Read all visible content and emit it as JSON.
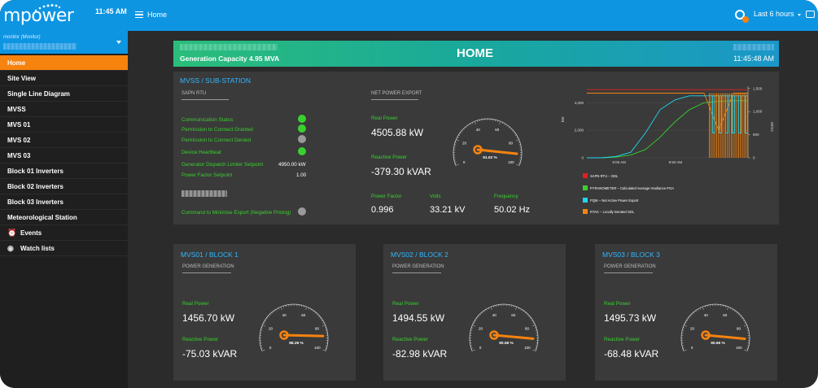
{
  "sidebar": {
    "logo_text": "mpower",
    "clock": "11:45 AM",
    "user": "monitor (Monitor)",
    "items": [
      {
        "label": "Home"
      },
      {
        "label": "Site View"
      },
      {
        "label": "Single Line Diagram"
      },
      {
        "label": "MVSS"
      },
      {
        "label": "MVS 01"
      },
      {
        "label": "MVS 02"
      },
      {
        "label": "MVS 03"
      },
      {
        "label": "Block 01 Inverters"
      },
      {
        "label": "Block 02 Inverters"
      },
      {
        "label": "Block 03 Inverters"
      },
      {
        "label": "Meteorological Station"
      },
      {
        "label": "Events",
        "icon": "alarm-clock-icon"
      },
      {
        "label": "Watch lists",
        "icon": "eye-icon"
      }
    ]
  },
  "topbar": {
    "title": "Home",
    "time_range": "Last 6 hours"
  },
  "banner": {
    "capacity": "Generation Capacity 4.95 MVA",
    "title": "HOME",
    "time": "11:45:48 AM"
  },
  "mvss": {
    "title": "MVSS / SUB-STATION",
    "rtu_label": "SAPN RTU",
    "export_label": "NET POWER EXPORT",
    "status": [
      {
        "label": "Communication Status",
        "state": "green"
      },
      {
        "label": "Permission to Connect Granted",
        "state": "green"
      },
      {
        "label": "Permission to Connect Denied",
        "state": "grey"
      },
      {
        "label": "Device Heartbeat",
        "state": "green"
      }
    ],
    "setpoint_label": "Generator Dispatch Limiter Setpoint",
    "setpoint_value": "4950.00 kW",
    "pf_setpoint_label": "Power Factor Setpoint",
    "pf_setpoint_value": "1.00",
    "command_label": "Command to Minimise Export (Negative Pricing)",
    "command_state": "grey",
    "real_power_label": "Real Power",
    "real_power": "4505.88 kW",
    "reactive_label": "Reactive Power",
    "reactive": "-379.30 kVAR",
    "pf_label": "Power Factor",
    "pf": "0.996",
    "volts_label": "Volts",
    "volts": "33.21 kV",
    "freq_label": "Frequency",
    "freq": "50.02 Hz",
    "gauge_value": 91.02,
    "gauge_text": "91.02 %"
  },
  "colors": {
    "accent": "#f7830f",
    "primary": "#0d95e2",
    "green": "#39d02f",
    "title": "#30b7ff"
  },
  "chart_data": {
    "type": "line",
    "x_ticks": [
      "9:05 AM",
      "9:50 AM"
    ],
    "y_left_ticks": [
      "0",
      "2,000",
      "4,000"
    ],
    "y_left_label": "kW",
    "y_right_ticks": [
      "0",
      "500",
      "1,000",
      "1,500"
    ],
    "y_right_label": "W/m2",
    "series": [
      {
        "name": "SAPN RTU – GDL",
        "color": "#e02020",
        "values": [
          4950,
          4950,
          4950,
          4950,
          4950,
          4950,
          4950,
          4950,
          4950,
          4950,
          4950,
          4950
        ]
      },
      {
        "name": "PYRANOMETER – Calculated Average Irradiance POA",
        "color": "#39d02f",
        "values": [
          0,
          0,
          60,
          200,
          600,
          1500,
          2600,
          3500,
          4000,
          4100,
          4150,
          4150
        ]
      },
      {
        "name": "PQM – Net Active Power Export",
        "color": "#1fd8f0",
        "values": [
          0,
          0,
          100,
          400,
          1800,
          3500,
          4200,
          4500,
          4500,
          4500,
          4500,
          4500
        ]
      },
      {
        "name": "RTAC – Locally Derated GDL",
        "color": "#f7830f",
        "values": [
          4700,
          4700,
          4700,
          4700,
          4700,
          4700,
          4700,
          4700,
          4700,
          2000,
          4700,
          4700
        ]
      }
    ]
  },
  "blocks": [
    {
      "title": "MVS01 / BLOCK 1",
      "sub": "POWER GENERATION",
      "real_label": "Real Power",
      "real": "1456.70 kW",
      "reactive_label": "Reactive Power",
      "reactive": "-75.03 kVAR",
      "gauge_value": 88.28,
      "gauge_text": "88.28 %"
    },
    {
      "title": "MVS02 / BLOCK 2",
      "sub": "POWER GENERATION",
      "real_label": "Real Power",
      "real": "1494.55 kW",
      "reactive_label": "Reactive Power",
      "reactive": "-82.98 kVAR",
      "gauge_value": 90.58,
      "gauge_text": "90.58 %"
    },
    {
      "title": "MVS03 / BLOCK 3",
      "sub": "POWER GENERATION",
      "real_label": "Real Power",
      "real": "1495.73 kW",
      "reactive_label": "Reactive Power",
      "reactive": "-68.48 kVAR",
      "gauge_value": 90.65,
      "gauge_text": "90.65 %"
    }
  ],
  "gauge_ticks": [
    "0",
    "20",
    "40",
    "60",
    "80",
    "100"
  ]
}
